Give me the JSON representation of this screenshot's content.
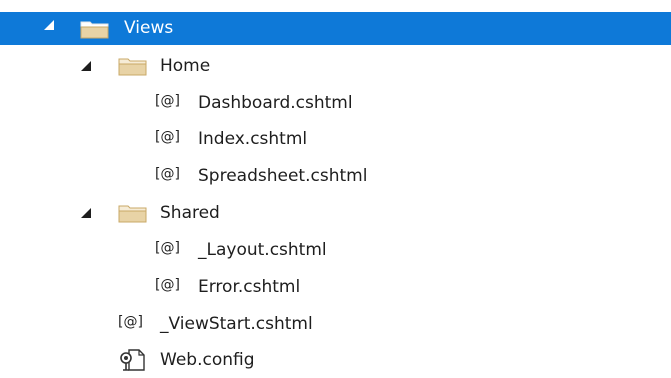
{
  "tree": {
    "views": {
      "label": "Views",
      "expanded": true,
      "selected": true
    },
    "home": {
      "label": "Home",
      "expanded": true
    },
    "home_files": [
      "Dashboard.cshtml",
      "Index.cshtml",
      "Spreadsheet.cshtml"
    ],
    "shared": {
      "label": "Shared",
      "expanded": true
    },
    "shared_files": [
      "_Layout.cshtml",
      "Error.cshtml"
    ],
    "viewstart": "_ViewStart.cshtml",
    "webconfig": "Web.config",
    "razor_glyph": "[@]"
  },
  "colors": {
    "selection": "#0e79d8",
    "folder_fill": "#e8d3a6",
    "folder_edge": "#c9a867",
    "text": "#1e1e1e"
  },
  "icons": {
    "folder": "folder-icon",
    "razor": "razor-file-icon",
    "config": "config-file-icon",
    "expander": "expanded-triangle-icon"
  }
}
